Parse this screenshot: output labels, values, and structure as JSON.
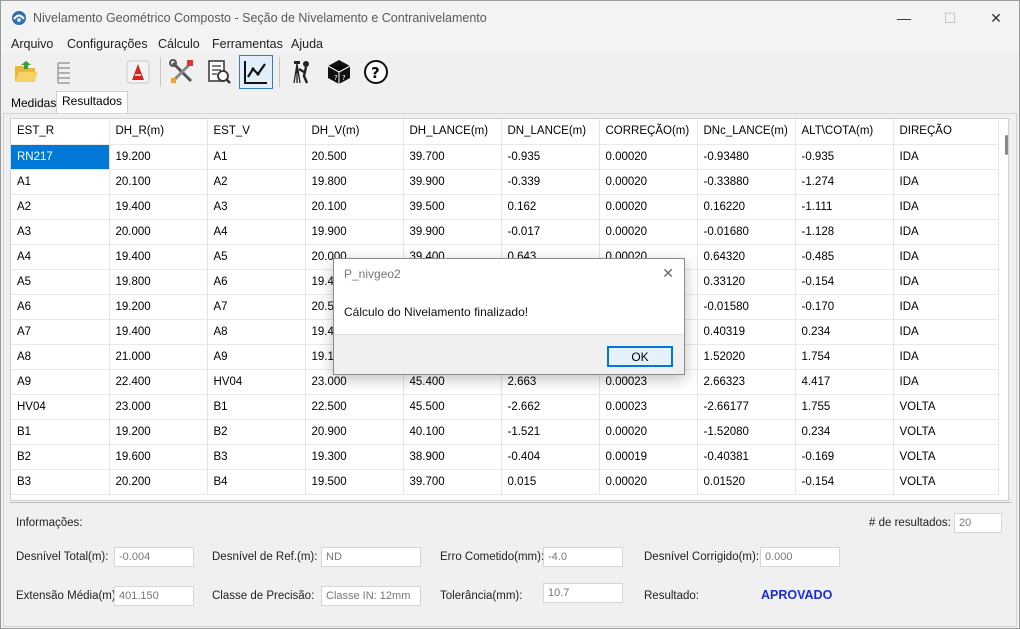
{
  "window": {
    "title": "Nivelamento Geométrico Composto - Seção de Nivelamento e Contranivelamento",
    "minimize": "—",
    "maximize": "☐",
    "close": "✕"
  },
  "menu": [
    "Arquivo",
    "Configurações",
    "Cálculo",
    "Ferramentas",
    "Ajuda"
  ],
  "toolbar": {
    "icons": [
      "open-folder-icon",
      "list-icon",
      "pdf-icon",
      "tools-icon",
      "report-search-icon",
      "chart-icon",
      "surveyor-icon",
      "cube-icon",
      "help-icon"
    ]
  },
  "tabs": [
    "Medidas",
    "Resultados"
  ],
  "table": {
    "columns": [
      "EST_R",
      "DH_R(m)",
      "EST_V",
      "DH_V(m)",
      "DH_LANCE(m)",
      "DN_LANCE(m)",
      "CORREÇÃO(m)",
      "DNc_LANCE(m)",
      "ALT\\COTA(m)",
      "DIREÇÃO"
    ],
    "rows": [
      [
        "RN217",
        "19.200",
        "A1",
        "20.500",
        "39.700",
        "-0.935",
        "0.00020",
        "-0.93480",
        "-0.935",
        "IDA"
      ],
      [
        "A1",
        "20.100",
        "A2",
        "19.800",
        "39.900",
        "-0.339",
        "0.00020",
        "-0.33880",
        "-1.274",
        "IDA"
      ],
      [
        "A2",
        "19.400",
        "A3",
        "20.100",
        "39.500",
        "0.162",
        "0.00020",
        "0.16220",
        "-1.111",
        "IDA"
      ],
      [
        "A3",
        "20.000",
        "A4",
        "19.900",
        "39.900",
        "-0.017",
        "0.00020",
        "-0.01680",
        "-1.128",
        "IDA"
      ],
      [
        "A4",
        "19.400",
        "A5",
        "20.000",
        "39.400",
        "0.643",
        "0.00020",
        "0.64320",
        "-0.485",
        "IDA"
      ],
      [
        "A5",
        "19.800",
        "A6",
        "19.40",
        "",
        "",
        "",
        "0.33120",
        "-0.154",
        "IDA"
      ],
      [
        "A6",
        "19.200",
        "A7",
        "20.50",
        "",
        "",
        "",
        "-0.01580",
        "-0.170",
        "IDA"
      ],
      [
        "A7",
        "19.400",
        "A8",
        "19.40",
        "",
        "",
        "",
        "0.40319",
        "0.234",
        "IDA"
      ],
      [
        "A8",
        "21.000",
        "A9",
        "19.10",
        "",
        "",
        "",
        "1.52020",
        "1.754",
        "IDA"
      ],
      [
        "A9",
        "22.400",
        "HV04",
        "23.000",
        "45.400",
        "2.663",
        "0.00023",
        "2.66323",
        "4.417",
        "IDA"
      ],
      [
        "HV04",
        "23.000",
        "B1",
        "22.500",
        "45.500",
        "-2.662",
        "0.00023",
        "-2.66177",
        "1.755",
        "VOLTA"
      ],
      [
        "B1",
        "19.200",
        "B2",
        "20.900",
        "40.100",
        "-1.521",
        "0.00020",
        "-1.52080",
        "0.234",
        "VOLTA"
      ],
      [
        "B2",
        "19.600",
        "B3",
        "19.300",
        "38.900",
        "-0.404",
        "0.00019",
        "-0.40381",
        "-0.169",
        "VOLTA"
      ],
      [
        "B3",
        "20.200",
        "B4",
        "19.500",
        "39.700",
        "0.015",
        "0.00020",
        "0.01520",
        "-0.154",
        "VOLTA"
      ]
    ]
  },
  "info": {
    "heading": "Informações:",
    "results_count_label": "# de resultados:",
    "results_count": "20",
    "desnivel_total_label": "Desnível Total(m):",
    "desnivel_total": "-0.004",
    "desnivel_ref_label": "Desnível de Ref.(m):",
    "desnivel_ref": "ND",
    "erro_label": "Erro Cometido(mm):",
    "erro": "-4.0",
    "desnivel_corrigido_label": "Desnível Corrigido(m):",
    "desnivel_corrigido": "0.000",
    "extensao_label": "Extensão Média(m):",
    "extensao": "401.150",
    "classe_label": "Classe de Precisão:",
    "classe": "Classe IN: 12mm",
    "tolerancia_label": "Tolerância(mm):",
    "tolerancia": "10.7",
    "resultado_label": "Resultado:",
    "resultado": "APROVADO"
  },
  "dialog": {
    "title": "P_nivgeo2",
    "close": "✕",
    "message": "Cálculo do Nivelamento finalizado!",
    "ok": "OK"
  },
  "colors": {
    "selection": "#0078d7",
    "result_text": "#1b2fd0"
  }
}
